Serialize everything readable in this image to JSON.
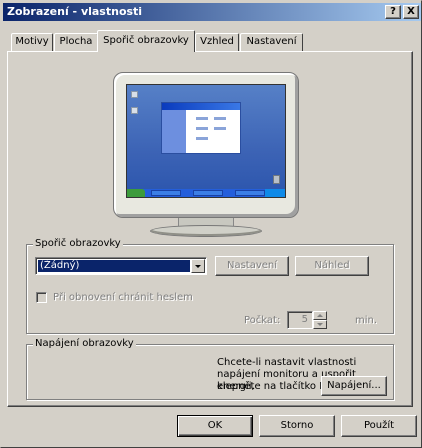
{
  "window": {
    "title": "Zobrazení - vlastnosti",
    "help_label": "?",
    "close_label": "X"
  },
  "tabs": [
    {
      "label": "Motivy",
      "active": false
    },
    {
      "label": "Plocha",
      "active": false
    },
    {
      "label": "Spořič obrazovky",
      "active": true
    },
    {
      "label": "Vzhled",
      "active": false
    },
    {
      "label": "Nastavení",
      "active": false
    }
  ],
  "screensaver": {
    "group_label": "Spořič obrazovky",
    "selected": "(Žádný)",
    "settings_label": "Nastavení",
    "preview_label": "Náhled",
    "password_label": "Při obnovení chránit heslem",
    "password_checked": false,
    "wait_label": "Počkat:",
    "wait_value": "5",
    "wait_unit": "min."
  },
  "power": {
    "group_label": "Napájení obrazovky",
    "description_line1": "Chcete-li nastavit vlastnosti",
    "description_line2": "napájení monitoru a uspořit energii,",
    "description_line3": "klepněte na tlačítko Napájení.",
    "button_label": "Napájení..."
  },
  "buttons": {
    "ok": "OK",
    "cancel": "Storno",
    "apply": "Použít"
  },
  "colors": {
    "face": "#d4d0c8",
    "title_active": "#0a246a",
    "selection": "#0a246a",
    "desktop": "#3a6ea5"
  }
}
